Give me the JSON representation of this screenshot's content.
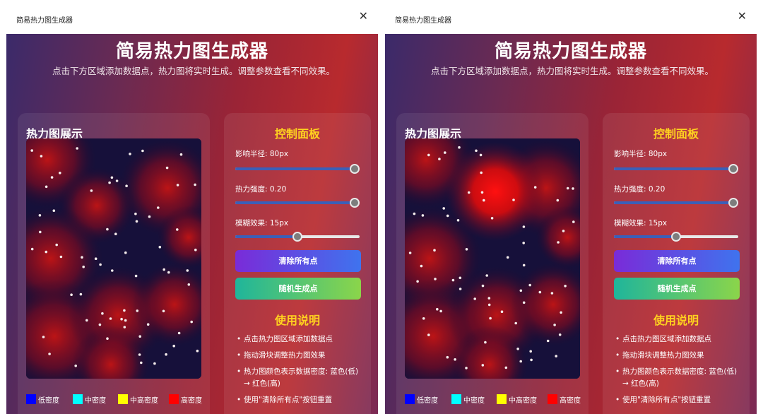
{
  "windows": [
    {
      "title": "简易热力图生成器",
      "app_title": "简易热力图生成器",
      "subtitle": "点击下方区域添加数据点，热力图将实时生成。调整参数查看不同效果。",
      "heat_title": "热力图展示",
      "controls_title": "控制面板",
      "params": [
        {
          "label": "影响半径: 80px",
          "value": 1.0
        },
        {
          "label": "热力强度: 0.20",
          "value": 1.0
        },
        {
          "label": "模糊效果: 15px",
          "value": 0.5
        }
      ],
      "buttons": {
        "clear": "清除所有点",
        "random": "随机生成点"
      },
      "help_title": "使用说明",
      "help_items": [
        "点击热力图区域添加数据点",
        "拖动滑块调整热力图效果",
        "热力图颜色表示数据密度: 蓝色(低) → 红色(高)",
        "使用\"清除所有点\"按钮重置"
      ],
      "legend": [
        {
          "label": "低密度",
          "color": "#0000ff"
        },
        {
          "label": "中密度",
          "color": "#00ffff"
        },
        {
          "label": "中高密度",
          "color": "#ffff00"
        },
        {
          "label": "高密度",
          "color": "#ff0000"
        }
      ]
    },
    {
      "title": "简易热力图生成器",
      "app_title": "简易热力图生成器",
      "subtitle": "点击下方区域添加数据点，热力图将实时生成。调整参数查看不同效果。",
      "heat_title": "热力图展示",
      "controls_title": "控制面板",
      "params": [
        {
          "label": "影响半径: 80px",
          "value": 1.0
        },
        {
          "label": "热力强度: 0.20",
          "value": 1.0
        },
        {
          "label": "模糊效果: 15px",
          "value": 0.5
        }
      ],
      "buttons": {
        "clear": "清除所有点",
        "random": "随机生成点"
      },
      "help_title": "使用说明",
      "help_items": [
        "点击热力图区域添加数据点",
        "拖动滑块调整热力图效果",
        "热力图颜色表示数据密度: 蓝色(低) → 红色(高)",
        "使用\"清除所有点\"按钮重置"
      ],
      "legend": [
        {
          "label": "低密度",
          "color": "#0000ff"
        },
        {
          "label": "中密度",
          "color": "#00ffff"
        },
        {
          "label": "中高密度",
          "color": "#ffff00"
        },
        {
          "label": "高密度",
          "color": "#ff0000"
        }
      ]
    }
  ],
  "icons": {
    "close": "close-icon"
  },
  "close_glyph": "✕"
}
